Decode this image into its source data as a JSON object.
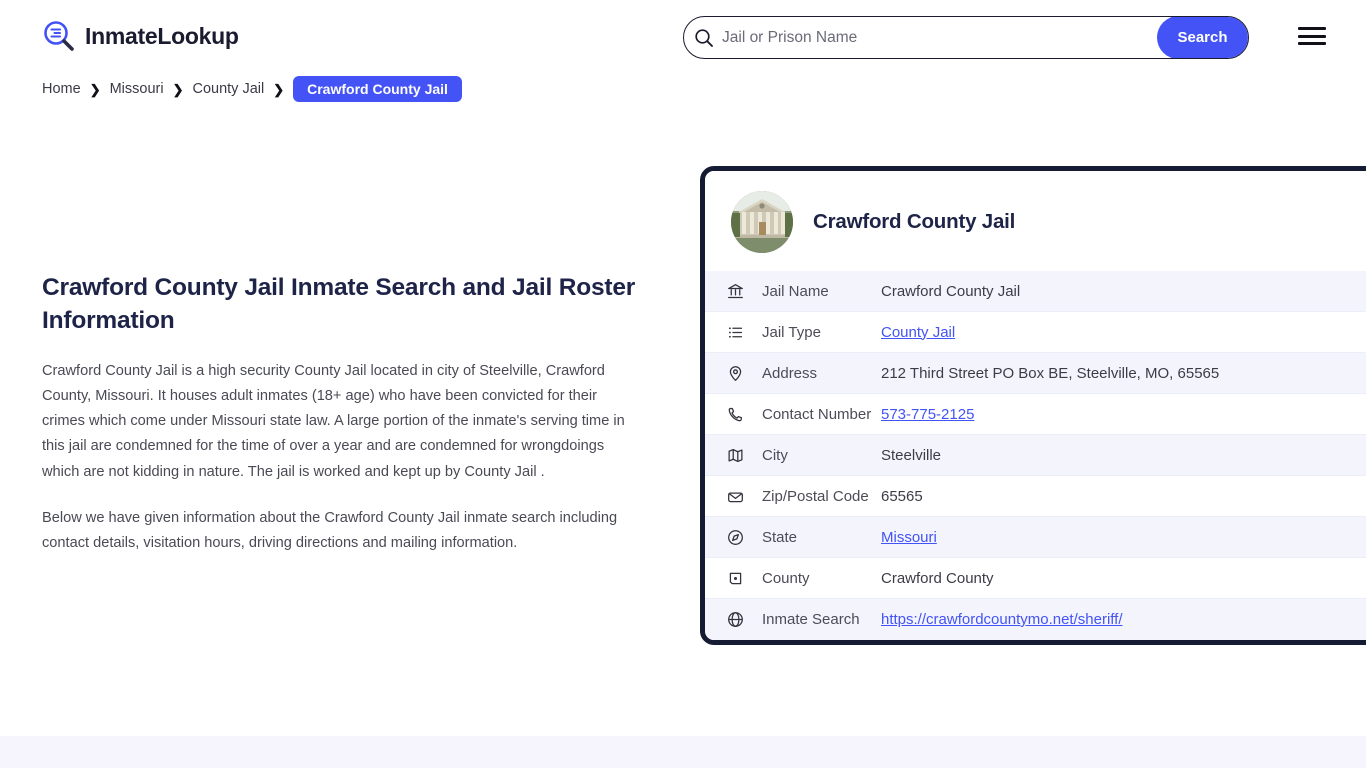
{
  "header": {
    "logo_text": "InmateLookup",
    "logo_icon": "magnifier-list-icon",
    "search": {
      "placeholder": "Jail or Prison Name",
      "value": "",
      "icon": "search-icon",
      "button_label": "Search"
    },
    "menu_icon": "hamburger-menu-icon"
  },
  "breadcrumb": {
    "items": [
      {
        "label": "Home",
        "current": false
      },
      {
        "label": "Missouri",
        "current": false
      },
      {
        "label": "County Jail",
        "current": false
      },
      {
        "label": "Crawford County Jail",
        "current": true
      }
    ],
    "separator": "❯"
  },
  "main": {
    "title": "Crawford County Jail Inmate Search and Jail Roster Information",
    "paragraphs": [
      "Crawford County Jail is a high security County Jail located in city of Steelville, Crawford County, Missouri. It houses adult inmates (18+ age) who have been convicted for their crimes which come under Missouri state law. A large portion of the inmate's serving time in this jail are condemned for the time of over a year and are condemned for wrongdoings which are not kidding in nature. The jail is worked and kept up by County Jail .",
      "Below we have given information about the Crawford County Jail inmate search including contact details, visitation hours, driving directions and mailing information."
    ]
  },
  "card": {
    "title": "Crawford County Jail",
    "thumbnail_alt": "courthouse-photo",
    "rows": [
      {
        "icon": "bank-icon",
        "label": "Jail Name",
        "value": "Crawford County Jail",
        "link": false
      },
      {
        "icon": "list-icon",
        "label": "Jail Type",
        "value": "County Jail",
        "link": true
      },
      {
        "icon": "map-pin-icon",
        "label": "Address",
        "value": "212 Third Street PO Box BE, Steelville, MO, 65565",
        "link": false
      },
      {
        "icon": "phone-icon",
        "label": "Contact Number",
        "value": "573-775-2125",
        "link": true
      },
      {
        "icon": "map-icon",
        "label": "City",
        "value": "Steelville",
        "link": false
      },
      {
        "icon": "envelope-icon",
        "label": "Zip/Postal Code",
        "value": "65565",
        "link": false
      },
      {
        "icon": "compass-icon",
        "label": "State",
        "value": "Missouri",
        "link": true
      },
      {
        "icon": "county-pin-icon",
        "label": "County",
        "value": "Crawford County",
        "link": false
      },
      {
        "icon": "globe-icon",
        "label": "Inmate Search",
        "value": "https://crawfordcountymo.net/sheriff/",
        "link": true
      }
    ]
  },
  "colors": {
    "accent": "#4353f5",
    "card_border": "#141b33",
    "heading": "#1e2348",
    "row_alt": "#f4f5fc",
    "footer_strip": "#f6f5fe"
  }
}
